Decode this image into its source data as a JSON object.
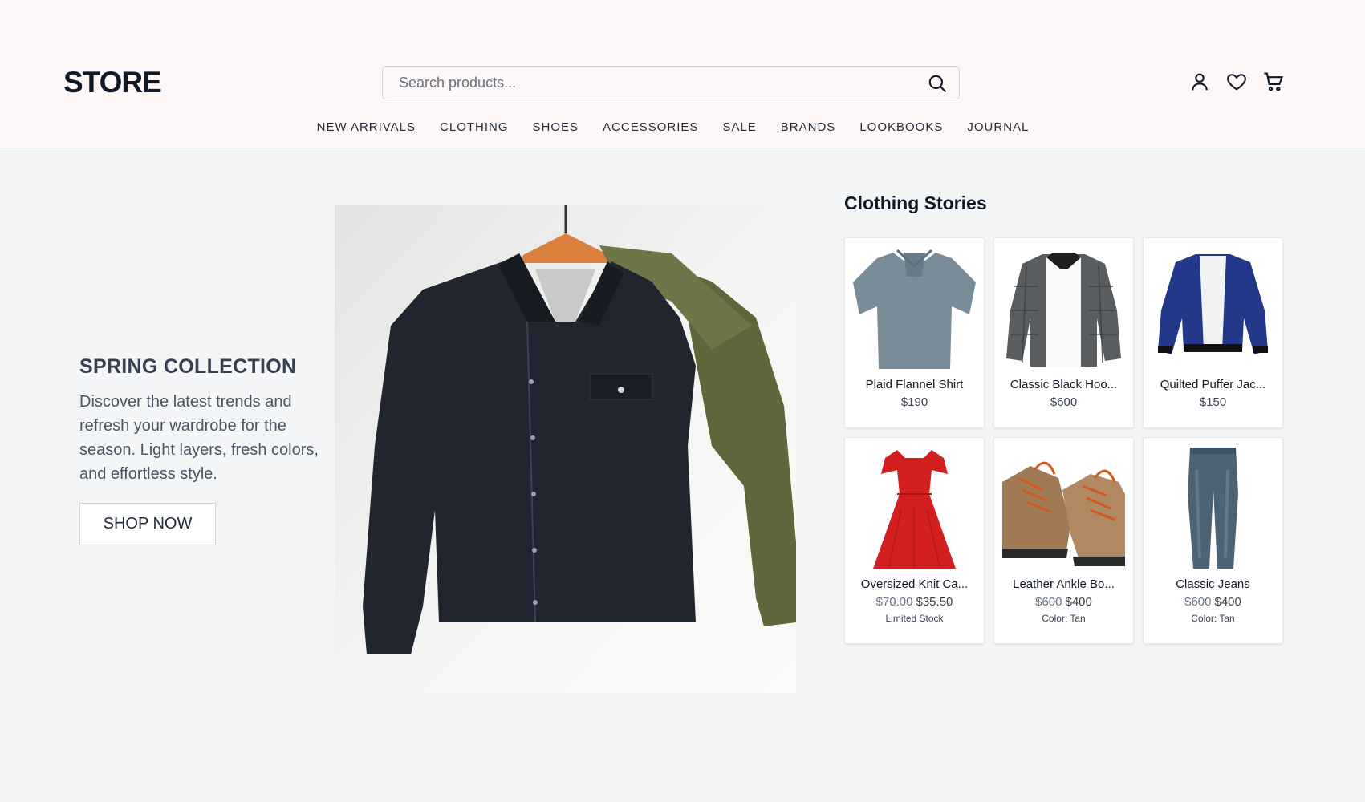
{
  "header": {
    "logo": "STORE",
    "search_placeholder": "Search products...",
    "nav": [
      "NEW ARRIVALS",
      "CLOTHING",
      "SHOES",
      "ACCESSORIES",
      "SALE",
      "BRANDS",
      "LOOKBOOKS",
      "JOURNAL"
    ],
    "icons": [
      "search-icon",
      "user-icon",
      "heart-icon",
      "cart-icon"
    ]
  },
  "hero": {
    "title": "SPRING COLLECTION",
    "description": "Discover the latest trends and refresh your wardrobe for the season. Light layers, fresh colors, and effortless style.",
    "button": "SHOP NOW"
  },
  "stories": {
    "title": "Clothing Stories",
    "products": [
      {
        "name": "Plaid Flannel Shirt",
        "price": "$190",
        "old_price": "",
        "note": ""
      },
      {
        "name": "Classic Black Hoo...",
        "price": "$600",
        "old_price": "",
        "note": ""
      },
      {
        "name": "Quilted Puffer Jac...",
        "price": "$150",
        "old_price": "",
        "note": ""
      },
      {
        "name": "Oversized Knit Ca...",
        "price": "$35.50",
        "old_price": "$70.00",
        "note": "Limited Stock"
      },
      {
        "name": "Leather Ankle Bo...",
        "price": "$400",
        "old_price": "$600",
        "note": "Color: Tan"
      },
      {
        "name": "Classic Jeans",
        "price": "$400",
        "old_price": "$600",
        "note": "Color: Tan"
      }
    ]
  }
}
